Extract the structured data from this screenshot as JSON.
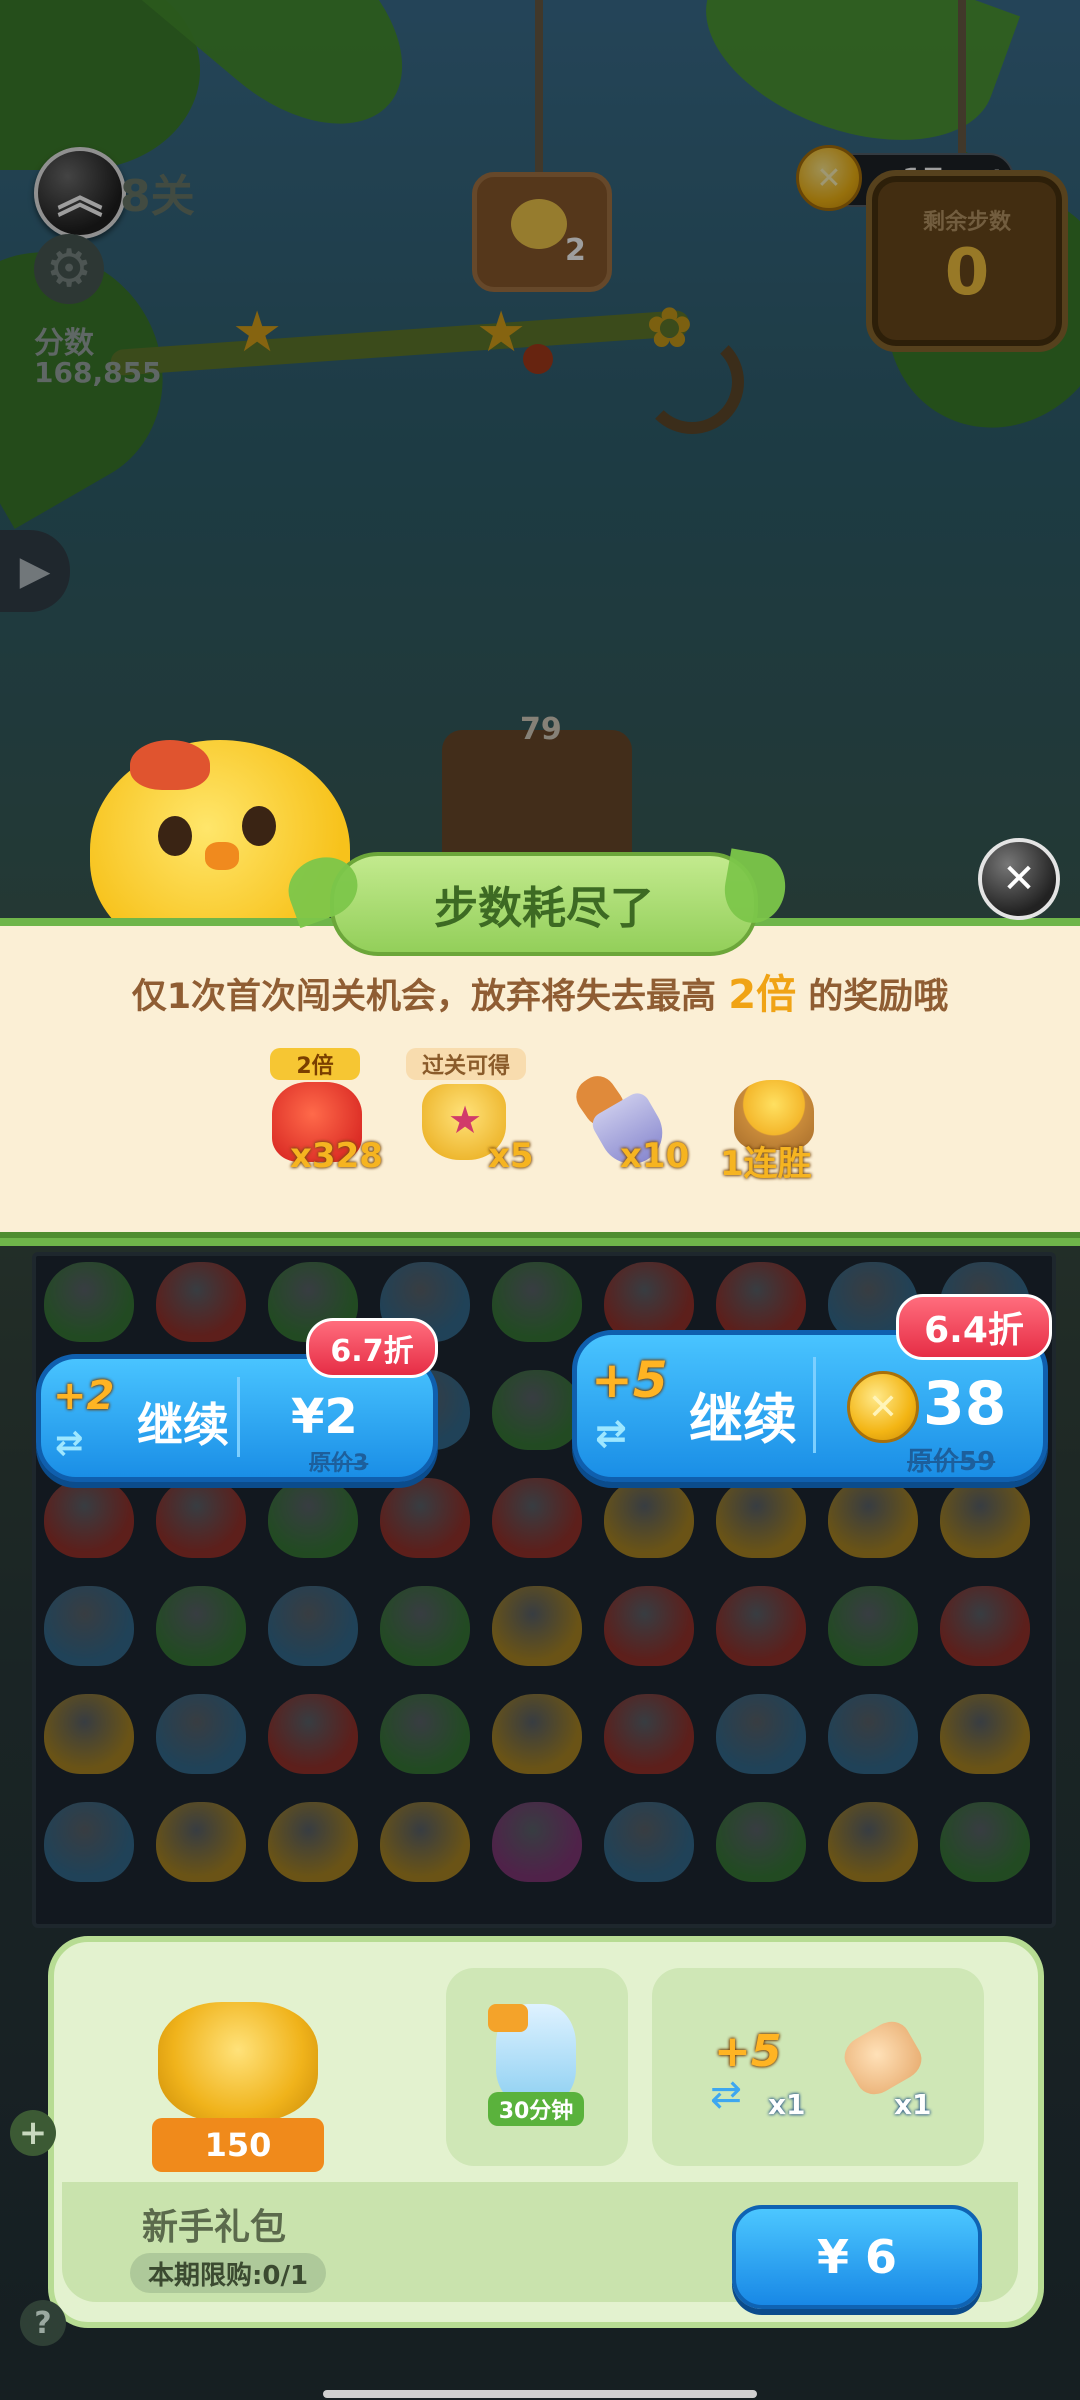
{
  "hud": {
    "level_label": "8关",
    "score_label": "分数",
    "score_value": "168,855",
    "coin_count": "17",
    "coin_plus": "+",
    "steps_label": "剩余步数",
    "steps_value": "0",
    "goal_count": "2",
    "board_count": "79"
  },
  "dialog": {
    "title": "步数耗尽了",
    "warning_pre": "仅1次首次闯关机会，放弃将失去最高",
    "warning_highlight": "2倍",
    "warning_post": "的奖励哦",
    "rewards": [
      {
        "tag": "2倍",
        "qty": "x328",
        "icon": "fox-jelly-icon"
      },
      {
        "tag": "过关可得",
        "qty": "x5",
        "icon": "trophy-icon"
      },
      {
        "tag": "",
        "qty": "x10",
        "icon": "shovel-icon"
      },
      {
        "tag": "",
        "qty": "1连胜",
        "icon": "chick-nest-icon"
      }
    ]
  },
  "offers": [
    {
      "discount": "6.7折",
      "plus": "+2",
      "label": "继续",
      "price": "¥2",
      "original": "原价3"
    },
    {
      "discount": "6.4折",
      "plus": "+5",
      "label": "继续",
      "price": "38",
      "original": "原价59"
    }
  ],
  "gift_pack": {
    "coins": "150",
    "timer_label": "30分钟",
    "item1_plus": "+5",
    "item1_qty": "x1",
    "item2_qty": "x1",
    "title": "新手礼包",
    "limit": "本期限购:0/1",
    "price": "¥ 6"
  },
  "colors": {
    "accent_blue": "#1a8ee6",
    "panel_green": "#6fb54a",
    "discount_red": "#e62d45",
    "gold": "#f0a315"
  }
}
